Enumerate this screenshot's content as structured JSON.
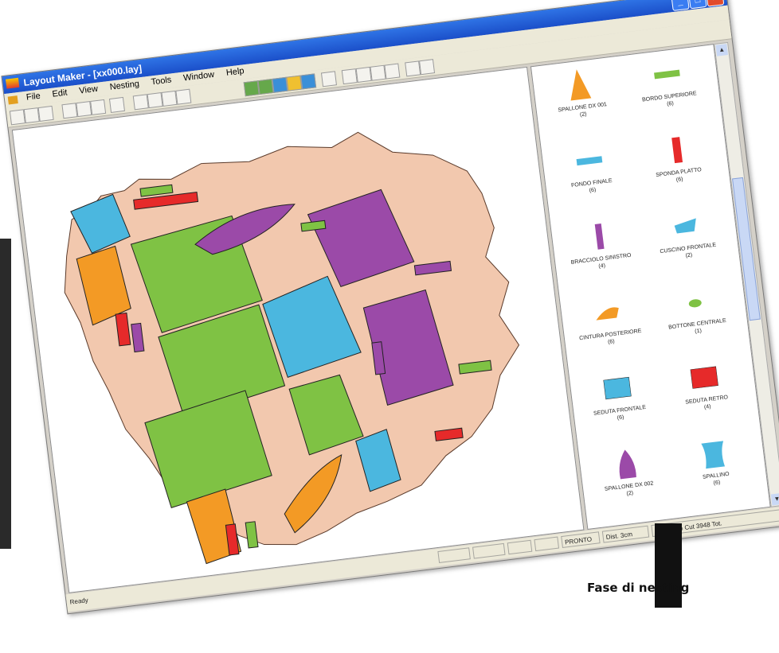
{
  "window": {
    "title": "Layout Maker - [xx000.lay]"
  },
  "menu": [
    "File",
    "Edit",
    "View",
    "Nesting",
    "Tools",
    "Window",
    "Help"
  ],
  "pieces": [
    {
      "label": "SPALLONE DX 001",
      "count": "(2)",
      "color": "#f39a25",
      "shape": "tri"
    },
    {
      "label": "BORDO SUPERIORE",
      "count": "(6)",
      "color": "#7fc244",
      "shape": "bar-h"
    },
    {
      "label": "FONDO FINALE",
      "count": "(6)",
      "color": "#4bb7df",
      "shape": "bar-h"
    },
    {
      "label": "SPONDA PLATTO",
      "count": "(6)",
      "color": "#e62a2a",
      "shape": "bar-v"
    },
    {
      "label": "BRACCIOLO SINISTRO",
      "count": "(4)",
      "color": "#9b4aa8",
      "shape": "bar-v"
    },
    {
      "label": "CUSCINO FRONTALE",
      "count": "(2)",
      "color": "#4bb7df",
      "shape": "small"
    },
    {
      "label": "CINTURA POSTERIORE",
      "count": "(6)",
      "color": "#f39a25",
      "shape": "wedge"
    },
    {
      "label": "BOTTONE CENTRALE",
      "count": "(1)",
      "color": "#7fc244",
      "shape": "blob"
    },
    {
      "label": "SEDUTA FRONTALE",
      "count": "(6)",
      "color": "#4bb7df",
      "shape": "rect"
    },
    {
      "label": "SEDUTA RETRO",
      "count": "(4)",
      "color": "#e62a2a",
      "shape": "rect"
    },
    {
      "label": "SPALLONE DX 002",
      "count": "(2)",
      "color": "#9b4aa8",
      "shape": "tri"
    },
    {
      "label": "SPALLINO",
      "count": "(6)",
      "color": "#4bb7df",
      "shape": "cup"
    }
  ],
  "status": {
    "ready": "Ready",
    "cells": [
      "",
      "",
      "",
      "",
      "PRONTO",
      "Dist. 3cm",
      "Area 22% Cut 3948 Tot."
    ]
  },
  "caption": "Fase di nesting",
  "colors": {
    "leather": "#f2c8ae",
    "green": "#7fc244",
    "purple": "#9b4aa8",
    "cyan": "#4bb7df",
    "orange": "#f39a25",
    "red": "#e62a2a"
  }
}
